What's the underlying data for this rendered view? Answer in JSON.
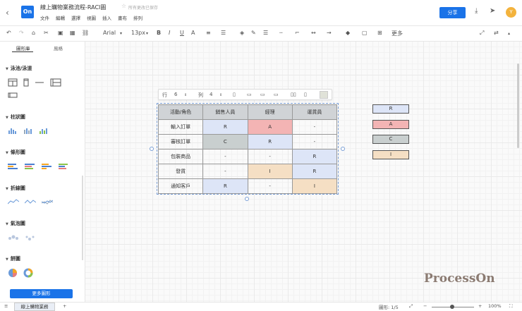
{
  "header": {
    "logo": "On",
    "title": "線上購物業務流程-RACI圖",
    "save_status": "所有更改已保存",
    "menu": [
      "文件",
      "編輯",
      "選擇",
      "視圖",
      "插入",
      "畫布",
      "排列"
    ],
    "share_label": "分享",
    "avatar_initial": "Y"
  },
  "toolbar": {
    "font_name": "Arial",
    "font_size": "13px",
    "more_label": "更多"
  },
  "sidebar": {
    "tabs": [
      "圖形庫",
      "風格"
    ],
    "sections": [
      "泳池/泳道",
      "柱狀圖",
      "條形圖",
      "折線圖",
      "氣泡圖",
      "餅圖"
    ],
    "more_button": "更多圖形"
  },
  "table_toolbar": {
    "rows_label": "行",
    "rows_value": "6",
    "cols_label": "列",
    "cols_value": "4"
  },
  "raci_table": {
    "headers": [
      "活動/角色",
      "銷售人員",
      "經理",
      "運貨員"
    ],
    "rows": [
      [
        "輸入訂單",
        "R",
        "A",
        "-"
      ],
      [
        "審核訂單",
        "C",
        "R",
        "-"
      ],
      [
        "包裝商品",
        "-",
        "-",
        "R"
      ],
      [
        "發貨",
        "-",
        "I",
        "R"
      ],
      [
        "通知客戶",
        "R",
        "-",
        "I"
      ]
    ]
  },
  "legend": [
    "R",
    "A",
    "C",
    "I"
  ],
  "colors": {
    "R": "#dde5f7",
    "A": "#f3b4b4",
    "C": "#c9cfcf",
    "I": "#f5dfc4",
    "header": "#d0d3d6",
    "accent": "#1a73e8"
  },
  "watermark": "ProcessOn",
  "bottom_bar": {
    "page_tab": "線上購物業務",
    "add_page": "+",
    "page_counter": "圖形: 1/5",
    "zoom": "100%"
  }
}
